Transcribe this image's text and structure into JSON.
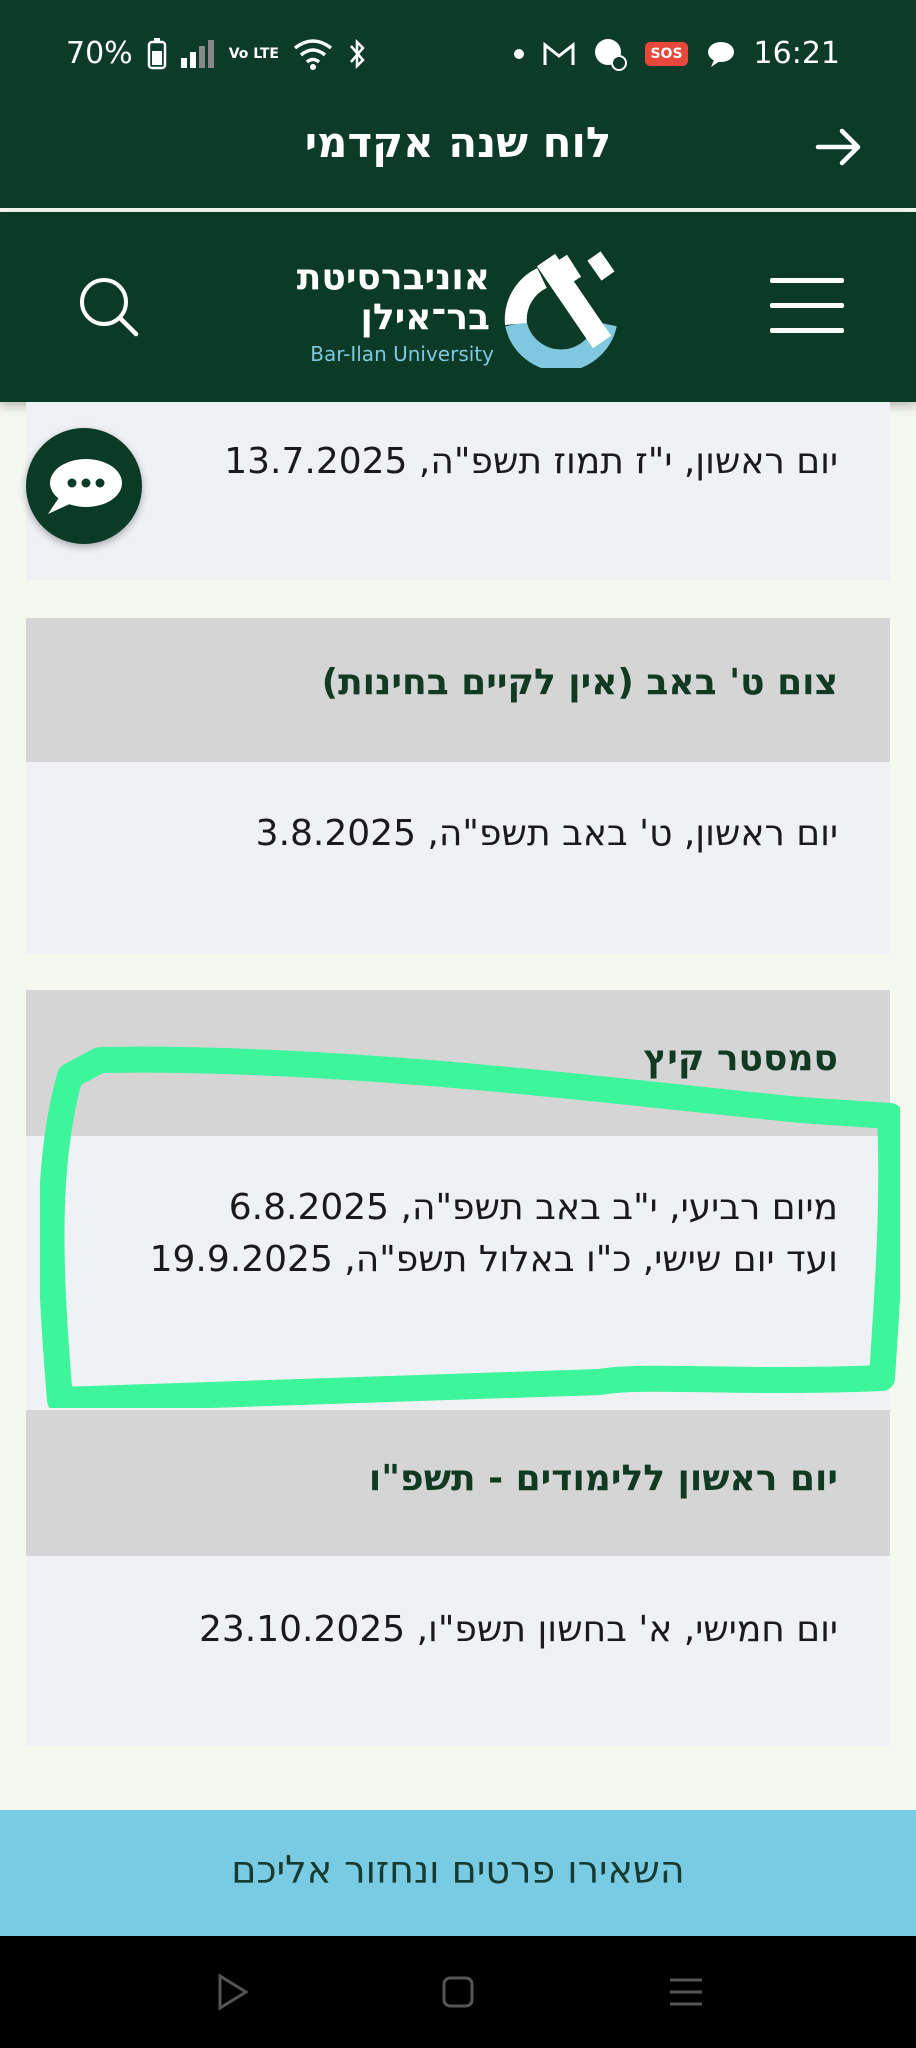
{
  "status_bar": {
    "battery": "70%",
    "network": "Vo LTE",
    "time": "16:21",
    "sos": "SOS",
    "icons": [
      "battery-icon",
      "signal-icon",
      "volte-icon",
      "wifi-icon",
      "bluetooth-icon",
      "dot-icon",
      "gmail-icon",
      "chat-app-icon",
      "sos-icon",
      "message-icon"
    ]
  },
  "title_bar": {
    "title": "לוח שנה אקדמי",
    "back_icon": "arrow-right-icon"
  },
  "header": {
    "logo_he_line1": "אוניברסיטת",
    "logo_he_line2": "בר־אילן",
    "logo_en": "Bar-Ilan University",
    "search_icon": "search-icon",
    "menu_icon": "hamburger-menu-icon"
  },
  "chat_button": {
    "icon": "chat-bubble-icon"
  },
  "events": [
    {
      "title": "",
      "body": [
        "יום ראשון, י\"ז תמוז תשפ\"ה, 13.7.2025"
      ]
    },
    {
      "title": "צום ט' באב (אין לקיים בחינות)",
      "body": [
        "יום ראשון, ט' באב תשפ\"ה, 3.8.2025"
      ]
    },
    {
      "title": "סמסטר קיץ",
      "body": [
        "מיום רביעי, י\"ב באב תשפ\"ה, 6.8.2025",
        "ועד יום שישי, כ\"ו באלול תשפ\"ה, 19.9.2025"
      ]
    },
    {
      "title": "יום ראשון ללימודים - תשפ\"ו",
      "body": [
        "יום חמישי, א' בחשון תשפ\"ו, 23.10.2025"
      ]
    }
  ],
  "cta": {
    "label": "השאירו פרטים ונחזור אליכם"
  },
  "colors": {
    "dark_green": "#0b3a27",
    "card_head": "#d5d5d5",
    "card_body": "#eff1f5",
    "highlight": "#3df59a",
    "cta": "#79cbe4"
  },
  "navbar": {
    "icons": [
      "recent-apps-icon",
      "home-icon",
      "back-icon"
    ]
  }
}
